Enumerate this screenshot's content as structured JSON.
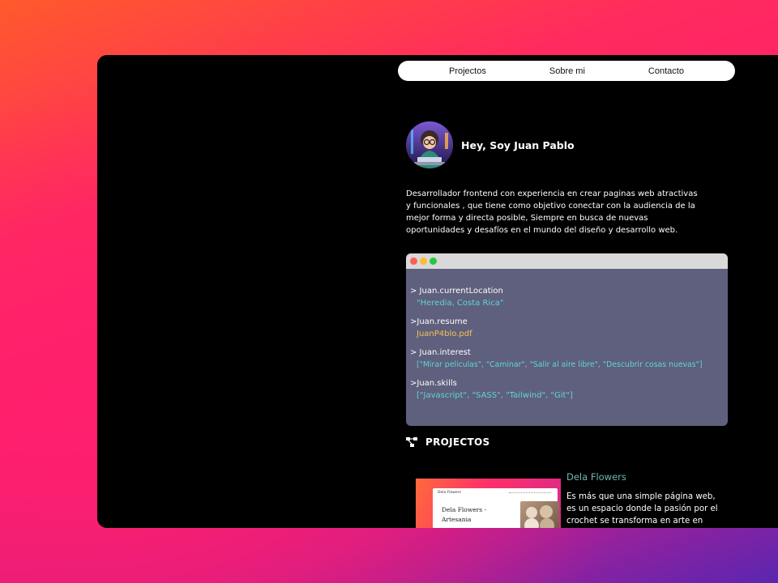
{
  "nav": {
    "items": [
      {
        "label": "Projectos"
      },
      {
        "label": "Sobre mi"
      },
      {
        "label": "Contacto"
      }
    ]
  },
  "profile": {
    "avatar_icon": "developer-avatar-illustration",
    "greeting": "Hey, Soy Juan Pablo"
  },
  "bio": {
    "text": "Desarrollador frontend con experiencia en crear paginas web atractivas y funcionales , que tiene como objetivo conectar con la audiencia de la mejor forma y directa posible, Siempre en busca de nuevas oportunidades y desafíos en el mundo del diseño y desarrollo web."
  },
  "terminal": {
    "dots": [
      "#ff5f57",
      "#ffbd2e",
      "#28c840"
    ],
    "entries": [
      {
        "command": "> Juan.currentLocation",
        "value": "\"Heredia, Costa Rica\"",
        "color": "#5fd7d0"
      },
      {
        "command": ">Juan.resume",
        "value": "JuanP4blo.pdf",
        "color": "#f5c451"
      },
      {
        "command": "> Juan.interest",
        "value": "[\"Mirar peliculas\", \"Caminar\", \"Salir al aire libre\", \"Descubrir cosas nuevas\"]",
        "color": "#5fd7d0"
      },
      {
        "command": ">Juan.skills",
        "value": "[\"Javascript\", \"SASS\", \"Tailwind\", \"Git\"]",
        "color": "#5fd7d0"
      }
    ]
  },
  "projects": {
    "icon": "project-diagram-icon",
    "heading": "PROJECTOS",
    "items": [
      {
        "title": "Dela Flowers",
        "description": "Es más que una simple página web, es un espacio donde la pasión por el crochet se transforma en arte en",
        "thumbnail": {
          "site_name": "Dela Flowers",
          "hero_text": "Dela Flowers - Artesania"
        }
      }
    ]
  }
}
